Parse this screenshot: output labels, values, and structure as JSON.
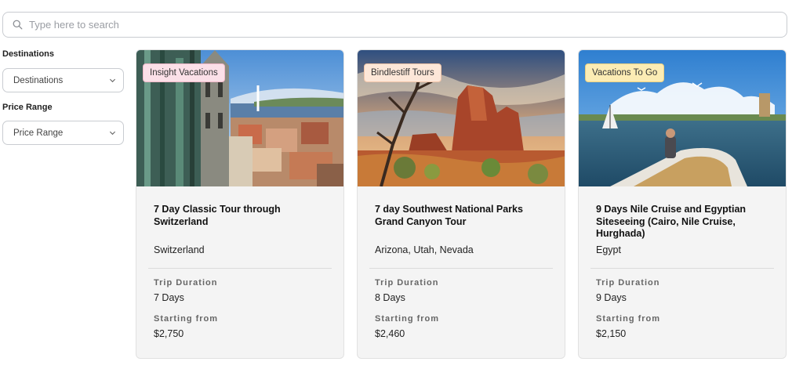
{
  "search": {
    "placeholder": "Type here to search"
  },
  "filters": {
    "destinations_label": "Destinations",
    "destinations_value": "Destinations",
    "price_label": "Price Range",
    "price_value": "Price Range"
  },
  "cards": [
    {
      "badge": "Insight Vacations",
      "title": "7 Day Classic Tour through Switzerland",
      "location": "Switzerland",
      "duration_label": "Trip Duration",
      "duration": "7 Days",
      "price_label": "Starting from",
      "price": "$2,750"
    },
    {
      "badge": "Bindlestiff Tours",
      "title": "7 day Southwest National Parks Grand Canyon Tour",
      "location": "Arizona, Utah, Nevada",
      "duration_label": "Trip Duration",
      "duration": "8 Days",
      "price_label": "Starting from",
      "price": "$2,460"
    },
    {
      "badge": "Vacations To Go",
      "title": "9 Days Nile Cruise and Egyptian Siteseeing (Cairo, Nile Cruise, Hurghada)",
      "location": "Egypt",
      "duration_label": "Trip Duration",
      "duration": "9 Days",
      "price_label": "Starting from",
      "price": "$2,150"
    }
  ]
}
